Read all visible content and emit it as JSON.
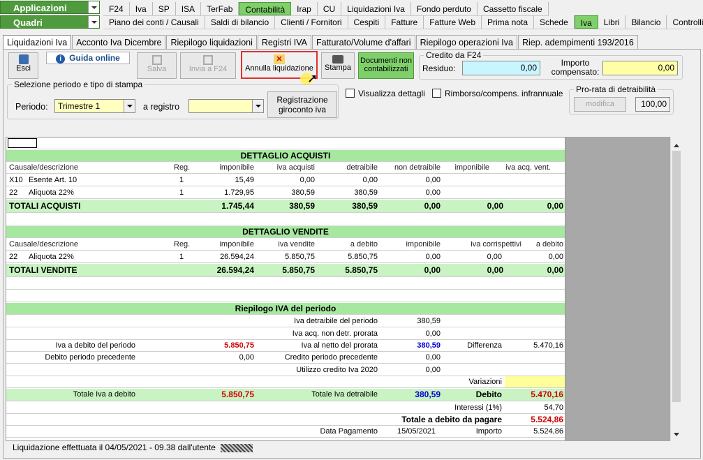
{
  "menu": {
    "side1": "Applicazioni",
    "side2": "Quadri",
    "row1": [
      "F24",
      "Iva",
      "SP",
      "ISA",
      "TerFab",
      "Contabilità",
      "Irap",
      "CU",
      "Liquidazioni Iva",
      "Fondo perduto",
      "Cassetto fiscale"
    ],
    "row2": [
      "Piano dei conti / Causali",
      "Saldi di bilancio",
      "Clienti / Fornitori",
      "Cespiti",
      "Fatture",
      "Fatture Web",
      "Prima nota",
      "Schede",
      "Iva",
      "Libri",
      "Bilancio",
      "Controlli"
    ]
  },
  "tabs": [
    "Liquidazioni Iva",
    "Acconto Iva Dicembre",
    "Riepilogo liquidazioni",
    "Registri IVA",
    "Fatturato/Volume d'affari",
    "Riepilogo operazioni Iva",
    "Riep. adempimenti 193/2016"
  ],
  "toolbar": {
    "esci": "Esci",
    "guida": "Guida online",
    "salva": "Salva",
    "invia": "Invia a F24",
    "annulla": "Annulla liquidazione",
    "stampa": "Stampa",
    "documenti": "Documenti non contabilizzati"
  },
  "credito": {
    "legend": "Credito da F24",
    "residuo_label": "Residuo:",
    "residuo": "0,00",
    "importo_label": "Importo compensato:",
    "importo": "0,00"
  },
  "selezione": {
    "legend": "Selezione periodo e tipo di stampa",
    "periodo_label": "Periodo:",
    "periodo": "Trimestre 1",
    "registro_label": "a registro",
    "registro": "",
    "giroconto": "Registrazione giroconto iva"
  },
  "options": {
    "dettagli": "Visualizza dettagli",
    "rimborso": "Rimborso/compens. infrannuale"
  },
  "prorata": {
    "legend": "Pro-rata di detraibilità",
    "modifica": "modifica",
    "value": "100,00"
  },
  "acquisti": {
    "title": "DETTAGLIO ACQUISTI",
    "headers": [
      "Causale/descrizione",
      "Reg.",
      "imponibile",
      "iva acquisti",
      "detraibile",
      "non detraibile",
      "imponibile",
      "iva acq. vent."
    ],
    "rows": [
      [
        "X10",
        "Esente Art. 10",
        "1",
        "15,49",
        "0,00",
        "0,00",
        "0,00"
      ],
      [
        "22",
        "Aliquota 22%",
        "1",
        "1.729,95",
        "380,59",
        "380,59",
        "0,00"
      ]
    ],
    "total": [
      "TOTALI ACQUISTI",
      "1.745,44",
      "380,59",
      "380,59",
      "0,00",
      "0,00",
      "0,00"
    ]
  },
  "vendite": {
    "title": "DETTAGLIO VENDITE",
    "headers": [
      "Causale/descrizione",
      "Reg.",
      "imponibile",
      "iva vendite",
      "a debito",
      "imponibile",
      "iva corrispettivi",
      "a debito"
    ],
    "rows": [
      [
        "22",
        "Aliquota 22%",
        "1",
        "26.594,24",
        "5.850,75",
        "5.850,75",
        "0,00",
        "0,00",
        "0,00"
      ]
    ],
    "total": [
      "TOTALI VENDITE",
      "26.594,24",
      "5.850,75",
      "5.850,75",
      "0,00",
      "0,00",
      "0,00"
    ]
  },
  "riepilogo": {
    "title": "Riepilogo IVA del periodo",
    "iva_detraibile_label": "Iva detraibile del periodo",
    "iva_detraibile": "380,59",
    "iva_non_detr_label": "Iva acq. non detr. prorata",
    "iva_non_detr": "0,00",
    "debito_periodo_label": "Iva a debito del periodo",
    "debito_periodo": "5.850,75",
    "netto_prorata_label": "Iva al netto del prorata",
    "netto_prorata": "380,59",
    "differenza_label": "Differenza",
    "differenza": "5.470,16",
    "debito_prec_label": "Debito periodo precedente",
    "debito_prec": "0,00",
    "credito_prec_label": "Credito periodo precedente",
    "credito_prec": "0,00",
    "utilizzo_label": "Utilizzo credito Iva 2020",
    "utilizzo": "0,00",
    "variazioni_label": "Variazioni",
    "tot_debito_label": "Totale Iva a debito",
    "tot_debito": "5.850,75",
    "tot_detraibile_label": "Totale Iva detraibile",
    "tot_detraibile": "380,59",
    "debito_label": "Debito",
    "debito": "5.470,16",
    "interessi_label": "Interessi (1%)",
    "interessi": "54,70",
    "totale_pagare_label": "Totale a debito da pagare",
    "totale_pagare": "5.524,86",
    "data_pag_label": "Data Pagamento",
    "data_pag": "15/05/2021",
    "importo_label": "Importo",
    "importo": "5.524,86"
  },
  "status": "Liquidazione effettuata il 04/05/2021 - 09.38 dall'utente"
}
